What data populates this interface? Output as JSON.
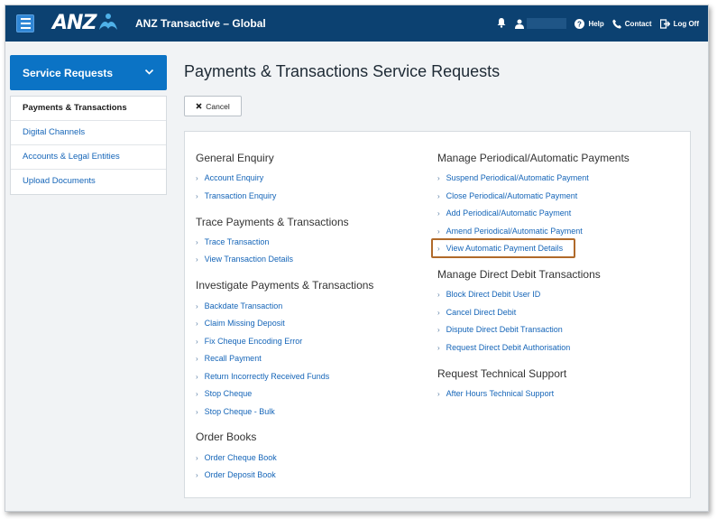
{
  "header": {
    "brand": "ANZ",
    "app_title": "ANZ Transactive – Global",
    "help_label": "Help",
    "contact_label": "Contact",
    "logoff_label": "Log Off"
  },
  "sidebar": {
    "title": "Service Requests",
    "items": [
      {
        "label": "Payments & Transactions"
      },
      {
        "label": "Digital Channels"
      },
      {
        "label": "Accounts & Legal Entities"
      },
      {
        "label": "Upload Documents"
      }
    ]
  },
  "main": {
    "title": "Payments & Transactions Service Requests",
    "cancel_label": "Cancel",
    "left_groups": [
      {
        "title": "General Enquiry",
        "links": [
          "Account Enquiry",
          "Transaction Enquiry"
        ]
      },
      {
        "title": "Trace Payments & Transactions",
        "links": [
          "Trace Transaction",
          "View Transaction Details"
        ]
      },
      {
        "title": "Investigate Payments & Transactions",
        "links": [
          "Backdate Transaction",
          "Claim Missing Deposit",
          "Fix Cheque Encoding Error",
          "Recall Payment",
          "Return Incorrectly Received Funds",
          "Stop Cheque",
          "Stop Cheque - Bulk"
        ]
      },
      {
        "title": "Order Books",
        "links": [
          "Order Cheque Book",
          "Order Deposit Book"
        ]
      }
    ],
    "right_groups": [
      {
        "title": "Manage Periodical/Automatic Payments",
        "links": [
          "Suspend Periodical/Automatic Payment",
          "Close Periodical/Automatic Payment",
          "Add Periodical/Automatic Payment",
          "Amend Periodical/Automatic Payment",
          "View Automatic Payment Details"
        ]
      },
      {
        "title": "Manage Direct Debit Transactions",
        "links": [
          "Block Direct Debit User ID",
          "Cancel Direct Debit",
          "Dispute Direct Debit Transaction",
          "Request Direct Debit Authorisation"
        ]
      },
      {
        "title": "Request Technical Support",
        "links": [
          "After Hours Technical Support"
        ]
      }
    ]
  },
  "colors": {
    "header_bg": "#0c4171",
    "accent_blue": "#0b73c5",
    "link_blue": "#1565b8",
    "highlight_border": "#b06a2a"
  }
}
